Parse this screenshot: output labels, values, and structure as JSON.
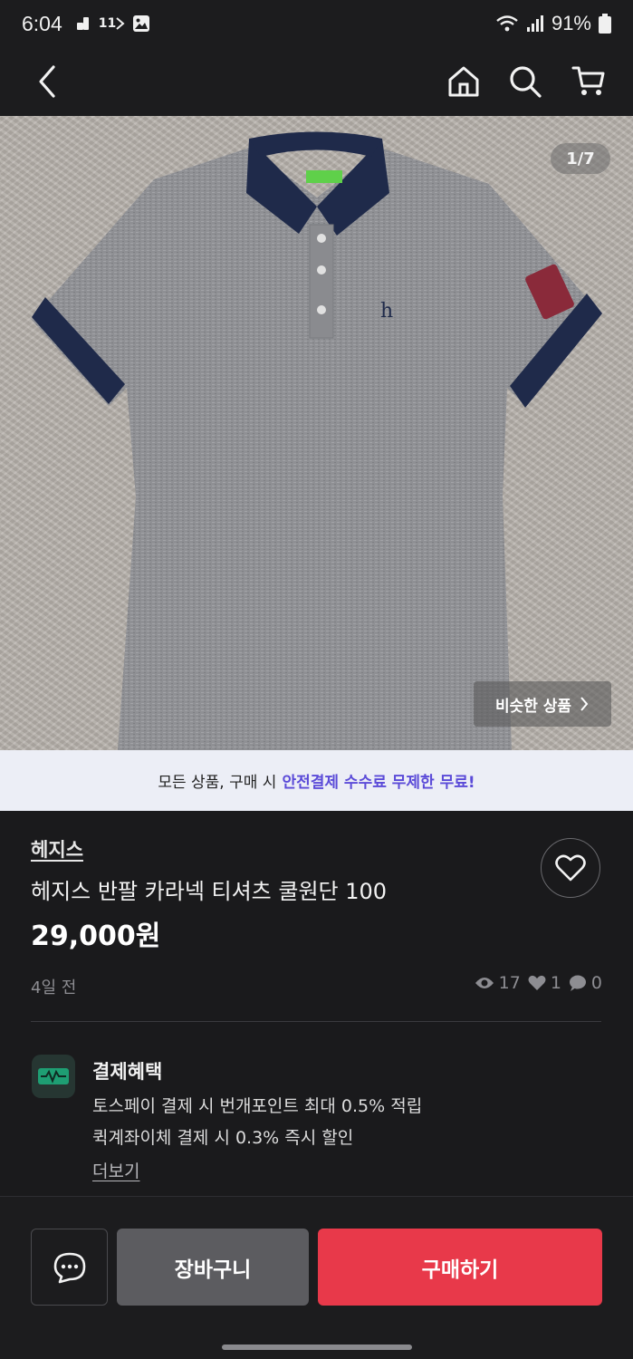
{
  "status_bar": {
    "time": "6:04",
    "battery": "91%",
    "icons": [
      "notification-icon",
      "carrier-11-icon",
      "gallery-icon",
      "wifi-icon",
      "signal-icon",
      "battery-icon"
    ],
    "carrier_label": "11"
  },
  "nav": {
    "icons": [
      "back-arrow-icon",
      "home-icon",
      "search-icon",
      "cart-icon"
    ]
  },
  "gallery": {
    "page_indicator": "1/7",
    "similar_label": "비슷한 상품"
  },
  "promo": {
    "prefix": "모든 상품, 구매 시",
    "highlight": "안전결제 수수료 무제한 무료!",
    "highlight_color": "#5b4bd8"
  },
  "product": {
    "brand": "헤지스",
    "title": "헤지스 반팔 카라넥 티셔츠 쿨원단 100",
    "price": "29,000원",
    "posted": "4일 전",
    "views": "17",
    "likes": "1",
    "chats": "0"
  },
  "benefit": {
    "title": "결제혜택",
    "line1": "토스페이 결제 시 번개포인트 최대 0.5% 적립",
    "line2": "퀵계좌이체 결제 시 0.3% 즉시 할인",
    "more": "더보기"
  },
  "actions": {
    "cart": "장바구니",
    "buy": "구매하기",
    "buy_color": "#e8394a"
  }
}
